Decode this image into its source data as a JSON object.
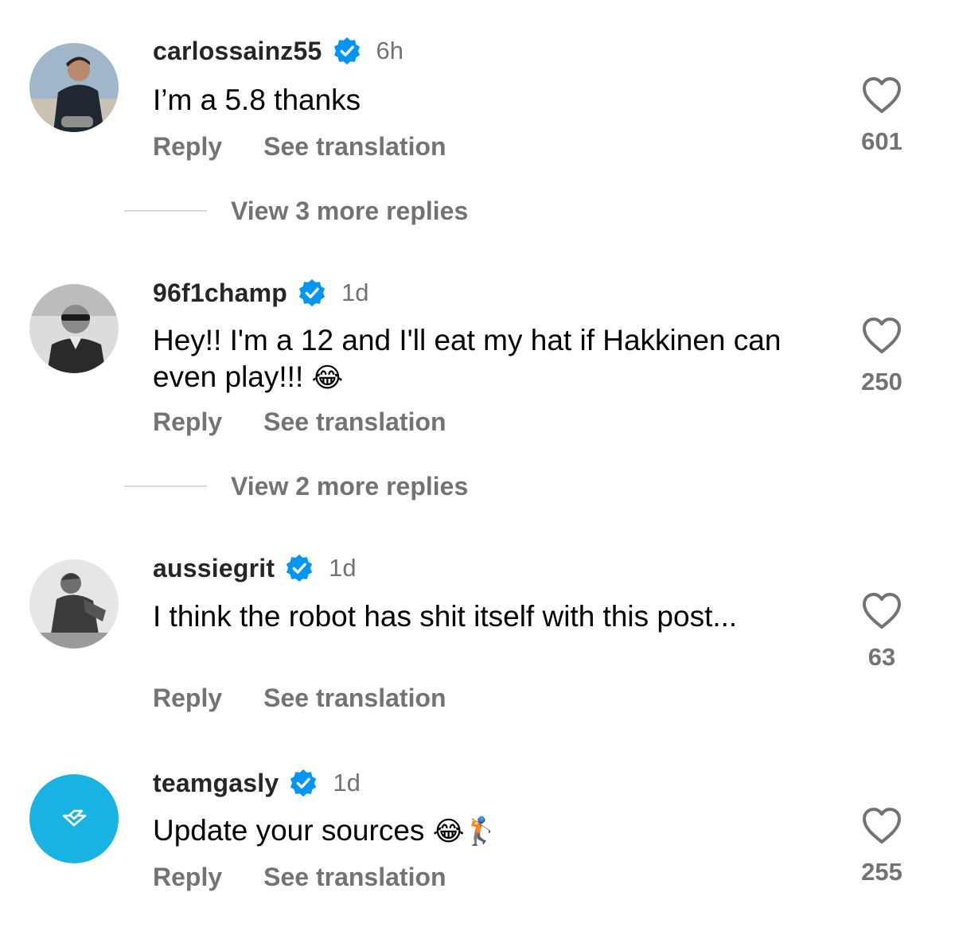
{
  "comments": [
    {
      "username": "carlossainz55",
      "time": "6h",
      "text": "I’m a 5.8 thanks",
      "reply_label": "Reply",
      "translate_label": "See translation",
      "likes": "601",
      "view_more": "View 3 more replies"
    },
    {
      "username": "96f1champ",
      "time": "1d",
      "text": "Hey!! I'm a 12 and I'll eat my hat if Hakkinen can even play!!!",
      "emoji": "😂",
      "reply_label": "Reply",
      "translate_label": "See translation",
      "likes": "250",
      "view_more": "View 2 more replies"
    },
    {
      "username": "aussiegrit",
      "time": "1d",
      "text": "I think the robot has shit itself with this post...",
      "reply_label": "Reply",
      "translate_label": "See translation",
      "likes": "63"
    },
    {
      "username": "teamgasly",
      "time": "1d",
      "text": "Update your sources",
      "emoji": "😂🏌",
      "reply_label": "Reply",
      "translate_label": "See translation",
      "likes": "255"
    }
  ],
  "colors": {
    "verified": "#0095f6",
    "muted": "#737373",
    "teamgasly_avatar": "#18b3e3"
  },
  "icons": {
    "verified": "verified-badge-icon",
    "like": "heart-outline-icon"
  }
}
